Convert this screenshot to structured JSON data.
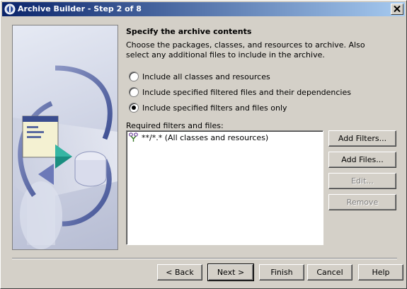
{
  "window": {
    "title": "Archive Builder - Step 2 of 8"
  },
  "content": {
    "heading": "Specify the archive contents",
    "description": "Choose the packages, classes, and resources to archive. Also select any additional files to include in the archive.",
    "options": [
      {
        "label": "Include all classes and resources",
        "checked": false
      },
      {
        "label": "Include specified filtered files and their dependencies",
        "checked": false
      },
      {
        "label": "Include specified filters and files only",
        "checked": true
      }
    ],
    "list_label": "Required filters and files:",
    "list_items": [
      {
        "text": "**/*.* (All classes and resources)",
        "icon": "filter-icon"
      }
    ],
    "side_buttons": {
      "add_filters": "Add Filters...",
      "add_files": "Add Files...",
      "edit": "Edit...",
      "remove": "Remove"
    }
  },
  "footer": {
    "back": "< Back",
    "next": "Next >",
    "finish": "Finish",
    "cancel": "Cancel",
    "help": "Help"
  }
}
